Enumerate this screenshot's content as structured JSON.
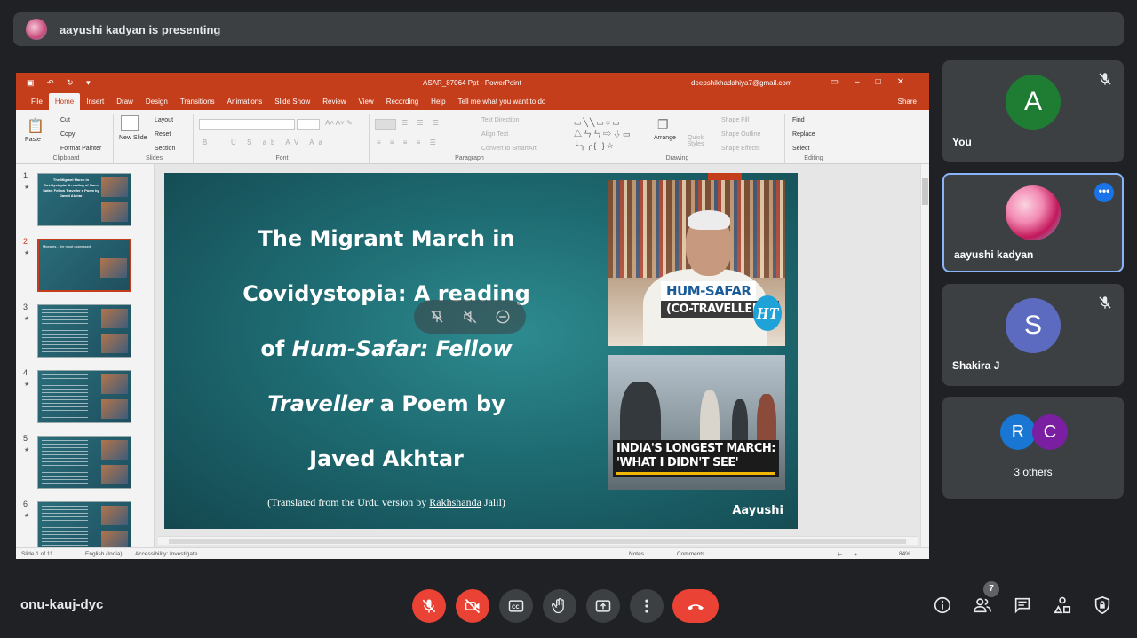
{
  "top_banner": {
    "text": "aayushi kadyan is presenting"
  },
  "powerpoint": {
    "file_name": "ASAR_87064  Ppt  -  PowerPoint",
    "user_email": "deepshikhadahiya7@gmail.com",
    "tabs": [
      "File",
      "Home",
      "Insert",
      "Draw",
      "Design",
      "Transitions",
      "Animations",
      "Slide Show",
      "Review",
      "View",
      "Recording",
      "Help",
      "Tell me what you want to do"
    ],
    "active_tab": "Home",
    "share_label": "Share",
    "ribbon": {
      "clipboard": {
        "label": "Clipboard",
        "paste": "Paste",
        "cut": "Cut",
        "copy": "Copy",
        "format_painter": "Format Painter"
      },
      "slides": {
        "label": "Slides",
        "new_slide": "New Slide",
        "layout": "Layout",
        "reset": "Reset",
        "section": "Section"
      },
      "font": {
        "label": "Font"
      },
      "paragraph": {
        "label": "Paragraph",
        "text_direction": "Text Direction",
        "align_text": "Align Text",
        "convert_smartart": "Convert to SmartArt"
      },
      "drawing": {
        "label": "Drawing",
        "arrange": "Arrange",
        "quick_styles": "Quick Styles",
        "shape_fill": "Shape Fill",
        "shape_outline": "Shape Outline",
        "shape_effects": "Shape Effects"
      },
      "editing": {
        "label": "Editing",
        "find": "Find",
        "replace": "Replace",
        "select": "Select"
      }
    },
    "thumbnails": [
      {
        "num": "1",
        "title": "The Migrant March in Covidystopia: A reading of Hum-Safar: Fellow Traveller a Poem by Javed Akhtar"
      },
      {
        "num": "2",
        "title": "Migrants - the most oppressed"
      },
      {
        "num": "3",
        "title": ""
      },
      {
        "num": "4",
        "title": ""
      },
      {
        "num": "5",
        "title": ""
      },
      {
        "num": "6",
        "title": ""
      }
    ],
    "slide": {
      "title_line1": "The Migrant March in",
      "title_line2": "Covidystopia: A reading",
      "title_line3a": "of ",
      "title_line3b": "Hum-Safar: Fellow",
      "title_line4a": "Traveller",
      "title_line4b": " a Poem by",
      "title_line5": "Javed Akhtar",
      "subtitle_a": "(Translated from the Urdu version by ",
      "subtitle_b": "Rakhshanda",
      "subtitle_c": " Jalil)",
      "img1_caption1": "HUM-SAFAR",
      "img1_caption2": "(CO-TRAVELLERS)",
      "img1_logo": "HT",
      "img2_caption1": "INDIA'S LONGEST MARCH:",
      "img2_caption2": "'WHAT I DIDN'T SEE'",
      "presenter_tag": "Aayushi"
    },
    "status_bar": {
      "slide_count": "Slide 1 of 11",
      "language": "English (India)",
      "accessibility": "Accessibility: Investigate",
      "notes": "Notes",
      "comments": "Comments",
      "zoom": "84%"
    }
  },
  "participants": [
    {
      "name": "You",
      "initial": "A",
      "color": "#1e7d32",
      "muted": true
    },
    {
      "name": "aayushi kadyan",
      "initial": "",
      "color": "#c2185b",
      "muted": false
    },
    {
      "name": "Shakira J",
      "initial": "S",
      "color": "#5c6bc0",
      "muted": true
    },
    {
      "name": "3 others",
      "initials": [
        "R",
        "C"
      ],
      "colors": [
        "#1976d2",
        "#7b1fa2"
      ]
    }
  ],
  "meeting": {
    "code": "onu-kauj-dyc",
    "people_count": "7"
  }
}
